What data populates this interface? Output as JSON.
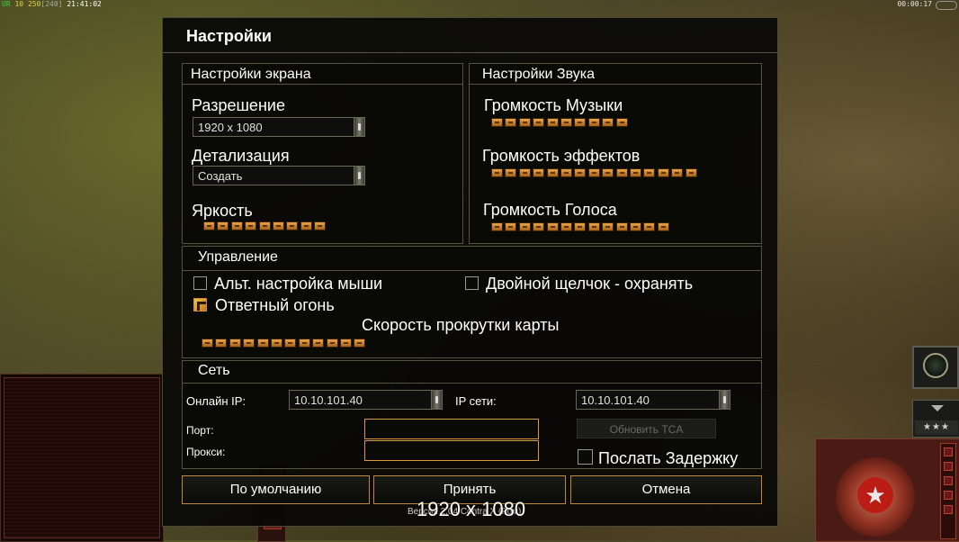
{
  "hud": {
    "fps_label": "UR",
    "fps_value": "10",
    "ping": "250",
    "ping_bracket": "[240]",
    "clock": "21:41:02",
    "timer": "00:00:17"
  },
  "dialog": {
    "title": "Настройки",
    "display": {
      "title": "Настройки экрана",
      "resolution_label": "Разрешение",
      "resolution_value": "1920 x 1080",
      "detail_label": "Детализация",
      "detail_value": "Создать",
      "brightness_label": "Яркость",
      "brightness_level": 9
    },
    "sound": {
      "title": "Настройки Звука",
      "music_label": "Громкость Музыки",
      "music_level": 10,
      "effects_label": "Громкость эффектов",
      "effects_level": 15,
      "voice_label": "Громкость Голоса",
      "voice_level": 13
    },
    "controls": {
      "title": "Управление",
      "alt_mouse_label": "Альт. настройка мыши",
      "alt_mouse_checked": false,
      "double_click_label": "Двойной щелчок - охранять",
      "double_click_checked": false,
      "retaliation_label": "Ответный огонь",
      "retaliation_checked": true,
      "scroll_speed_label": "Скорость прокрутки карты",
      "scroll_speed_level": 12
    },
    "network": {
      "title": "Сеть",
      "online_ip_label": "Онлайн IP:",
      "online_ip_value": "10.10.101.40",
      "lan_ip_label": "IP сети:",
      "lan_ip_value": "10.10.101.40",
      "port_label": "Порт:",
      "port_value": "",
      "proxy_label": "Прокси:",
      "proxy_value": "",
      "update_button": "Обновить TCA",
      "send_delay_label": "Послать Задержку",
      "send_delay_checked": false
    },
    "buttons": {
      "defaults": "По умолчанию",
      "accept": "Принять",
      "cancel": "Отмена"
    },
    "version": "Версия 2.04 Contra X (Ром)"
  },
  "overlay_text": "1920 x 1080",
  "colors": {
    "accent": "#d89a3a",
    "slider": "#e9a445",
    "panel_border": "#55533f"
  },
  "icons": {
    "radar": "radar-icon",
    "rank_arrow": "chevron-down-icon",
    "emblem": "red-star-icon"
  }
}
